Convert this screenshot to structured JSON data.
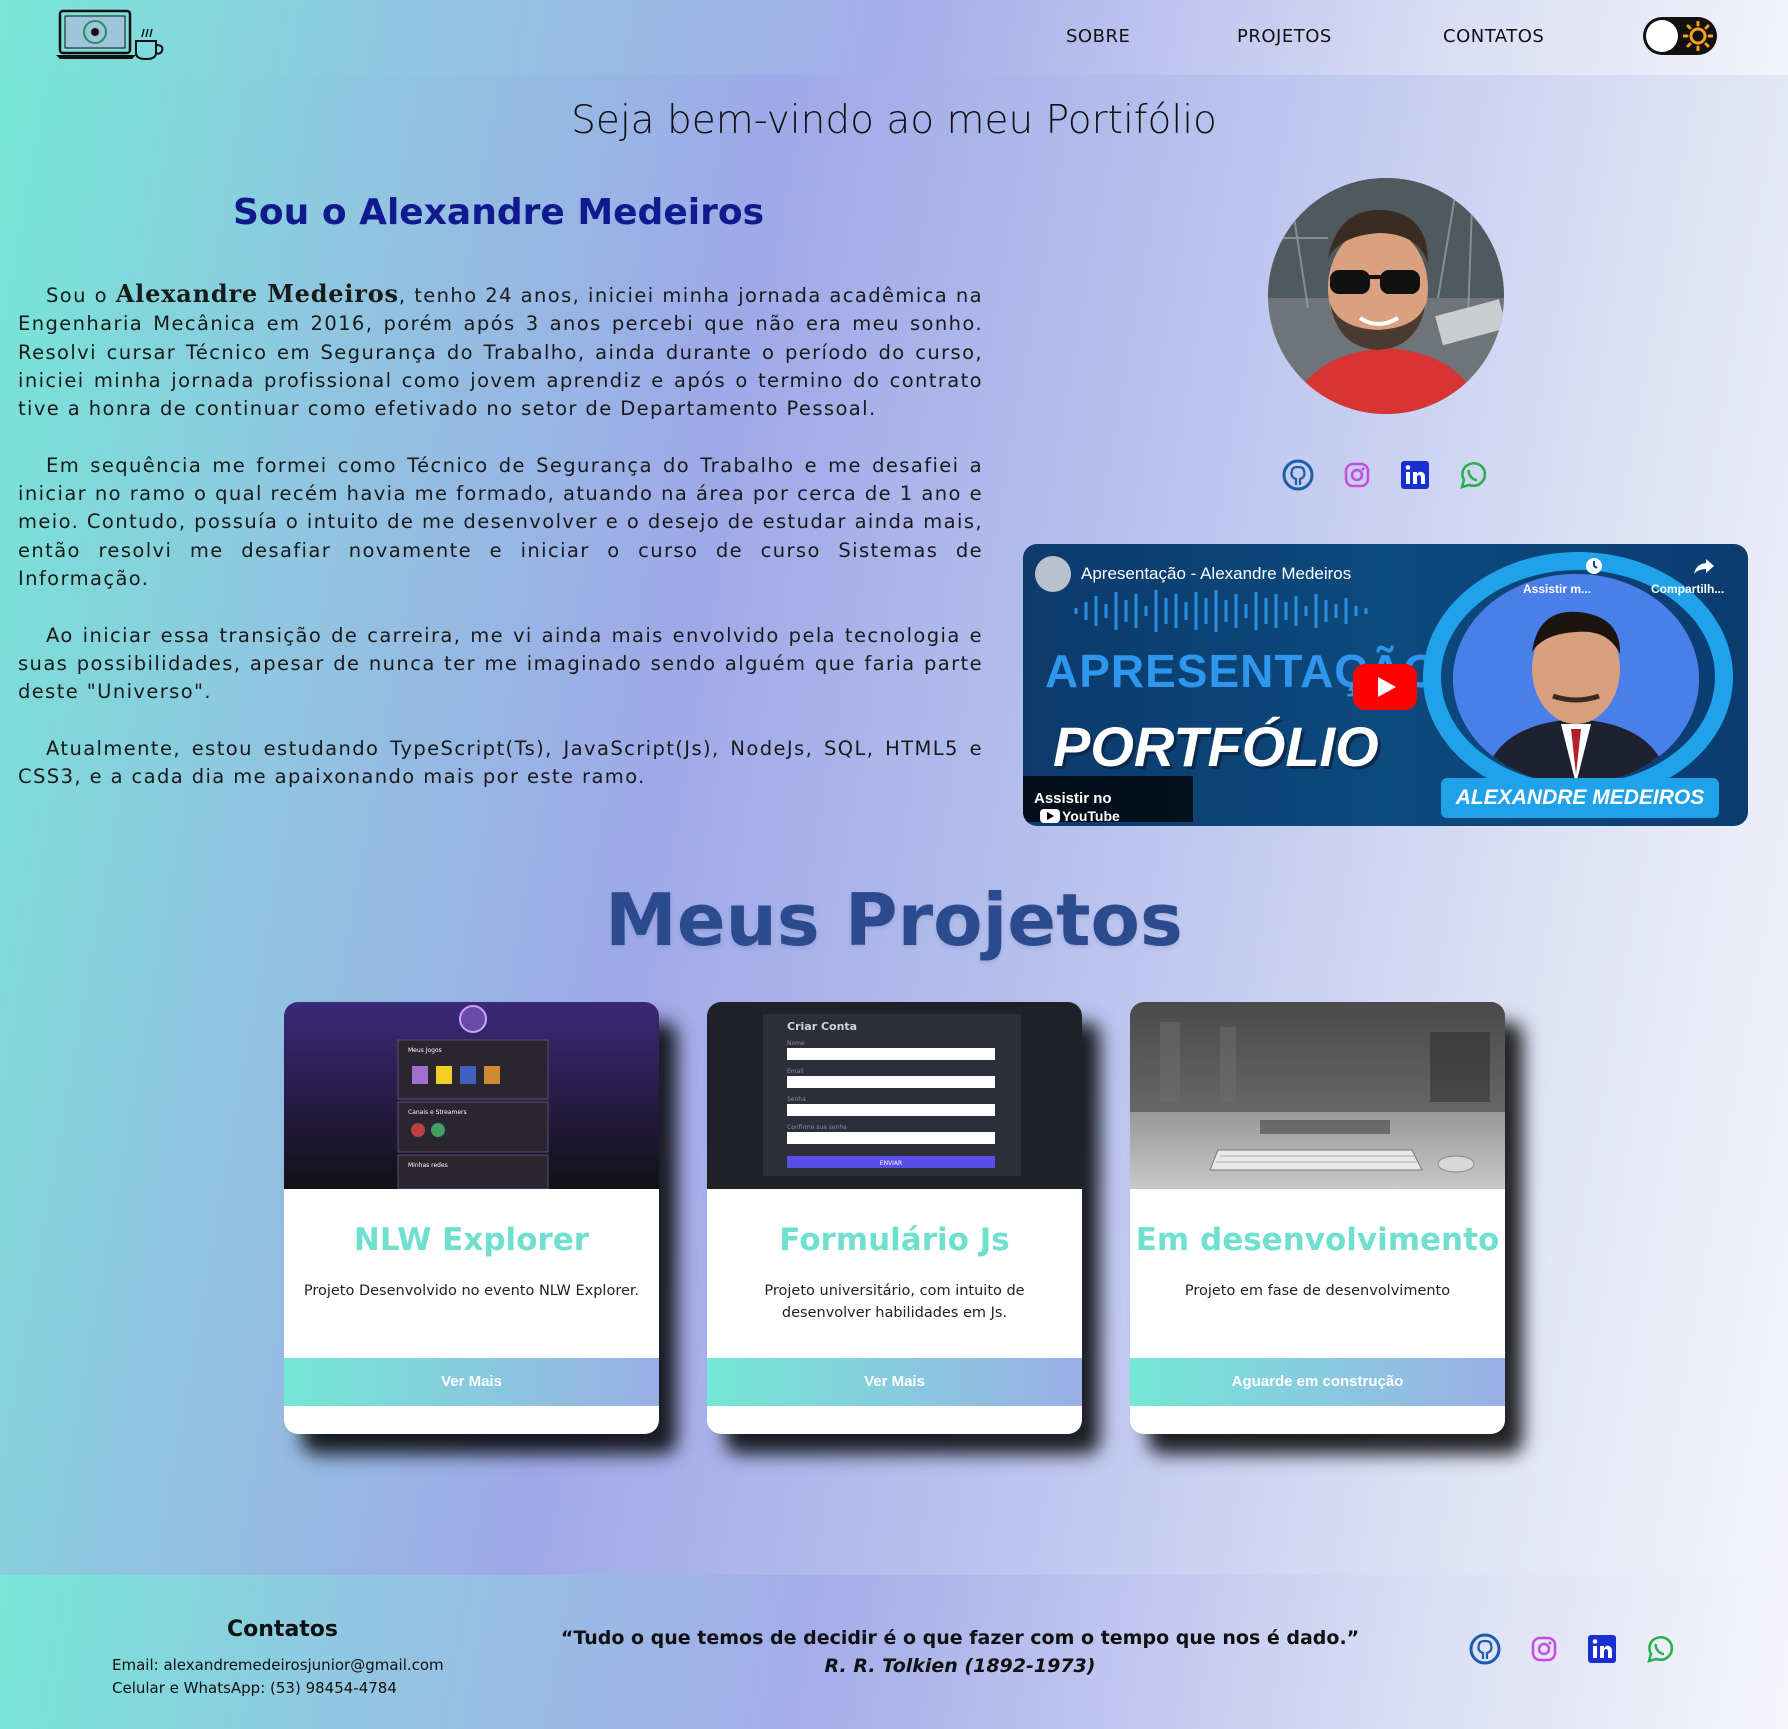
{
  "header": {
    "nav": [
      "SOBRE",
      "PROJETOS",
      "CONTATOS"
    ],
    "theme_toggle": "light",
    "logo_icon": "laptop-coffee-logo"
  },
  "hero": {
    "welcome": "Seja bem-vindo ao meu Portifólio",
    "hello": "Sou o Alexandre Medeiros",
    "about": {
      "p1_prefix": "Sou o ",
      "p1_name": "Alexandre Medeiros",
      "p1_rest": ", tenho 24 anos, iniciei minha jornada acadêmica na Engenharia Mecânica em 2016, porém após 3 anos percebi que não era meu sonho. Resolvi cursar Técnico em Segurança do Trabalho, ainda durante o período do curso, iniciei minha jornada profissional como jovem aprendiz e após o termino do contrato tive a honra de continuar como efetivado no setor de Departamento Pessoal.",
      "p2": "Em sequência me formei como Técnico de Segurança do Trabalho e me desafiei a iniciar no ramo o qual recém havia me formado, atuando na área por cerca de 1 ano e meio. Contudo, possuía o intuito de me desenvolver e o desejo de estudar ainda mais, então resolvi me desafiar novamente e iniciar o curso de curso Sistemas de Informação.",
      "p3": "Ao iniciar essa transição de carreira, me vi ainda mais envolvido pela tecnologia e suas possibilidades, apesar de nunca ter me imaginado sendo alguém que faria parte deste \"Universo\".",
      "p4": "Atualmente, estou estudando TypeScript(Ts), JavaScript(Js), NodeJs, SQL, HTML5 e CSS3, e a cada dia me apaixonando mais por este ramo."
    },
    "socials": [
      "github-icon",
      "instagram-icon",
      "linkedin-icon",
      "whatsapp-icon"
    ],
    "video": {
      "title": "Apresentação - Alexandre Medeiros",
      "big1": "APRESENTAÇÃO",
      "big2": "PORTFÓLIO",
      "name_banner": "ALEXANDRE MEDEIROS",
      "watch_later": "Assistir m...",
      "share": "Compartilh...",
      "watch_on": "Assistir no",
      "youtube": "YouTube"
    }
  },
  "projects": {
    "title": "Meus Projetos",
    "cards": [
      {
        "title": "NLW Explorer",
        "desc": "Projeto Desenvolvido no evento NLW Explorer.",
        "button": "Ver Mais"
      },
      {
        "title": "Formulário Js",
        "desc": "Projeto universitário, com intuito de desenvolver habilidades em Js.",
        "button": "Ver Mais"
      },
      {
        "title": "Em desenvolvimento",
        "desc": "Projeto em fase de desenvolvimento",
        "button": "Aguarde em construção"
      }
    ],
    "thumb1": {
      "heading": "Meus Jogos",
      "section2": "Canais e Streamers",
      "section3": "Minhas redes"
    },
    "thumb2": {
      "heading": "Criar Conta",
      "fields": [
        "Nome",
        "Email",
        "Senha",
        "Confirme sua senha"
      ],
      "submit": "ENVIAR"
    }
  },
  "footer": {
    "contacts_title": "Contatos",
    "email": "Email: alexandremedeirosjunior@gmail.com",
    "phone": "Celular e WhatsApp: (53) 98454-4784",
    "quote": "“Tudo o que temos de decidir é o que fazer com o tempo que nos é dado.”",
    "author": "R. R. Tolkien (1892-1973)"
  },
  "colors": {
    "accent_teal": "#6fe0cf",
    "hello_blue": "#101a8e",
    "projects_title": "#2c4b8e"
  }
}
